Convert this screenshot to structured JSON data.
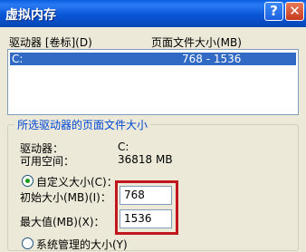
{
  "window": {
    "title": "虚拟内存"
  },
  "titlebar": {
    "help_glyph": "?",
    "close_glyph": "✕"
  },
  "list": {
    "col_drive": "驱动器 [卷标](D)",
    "col_size": "页面文件大小(MB)",
    "rows": [
      {
        "drive": "C:",
        "size": "768 - 1536"
      }
    ]
  },
  "selected": {
    "legend": "所选驱动器的页面文件大小",
    "drive_label": "驱动器：",
    "drive_value": "C:",
    "space_label": "可用空间：",
    "space_value": "36818 MB",
    "custom_label": "自定义大小(C)：",
    "initial_label": "初始大小(MB)(I)：",
    "initial_value": "768",
    "max_label": "最大值(MB)(X)：",
    "max_value": "1536",
    "system_label": "系统管理的大小(Y)"
  },
  "colors": {
    "title_bar": "#0a5fe0",
    "highlight_border": "#c0171e",
    "selection": "#316ac5",
    "legend_text": "#0046d5"
  }
}
